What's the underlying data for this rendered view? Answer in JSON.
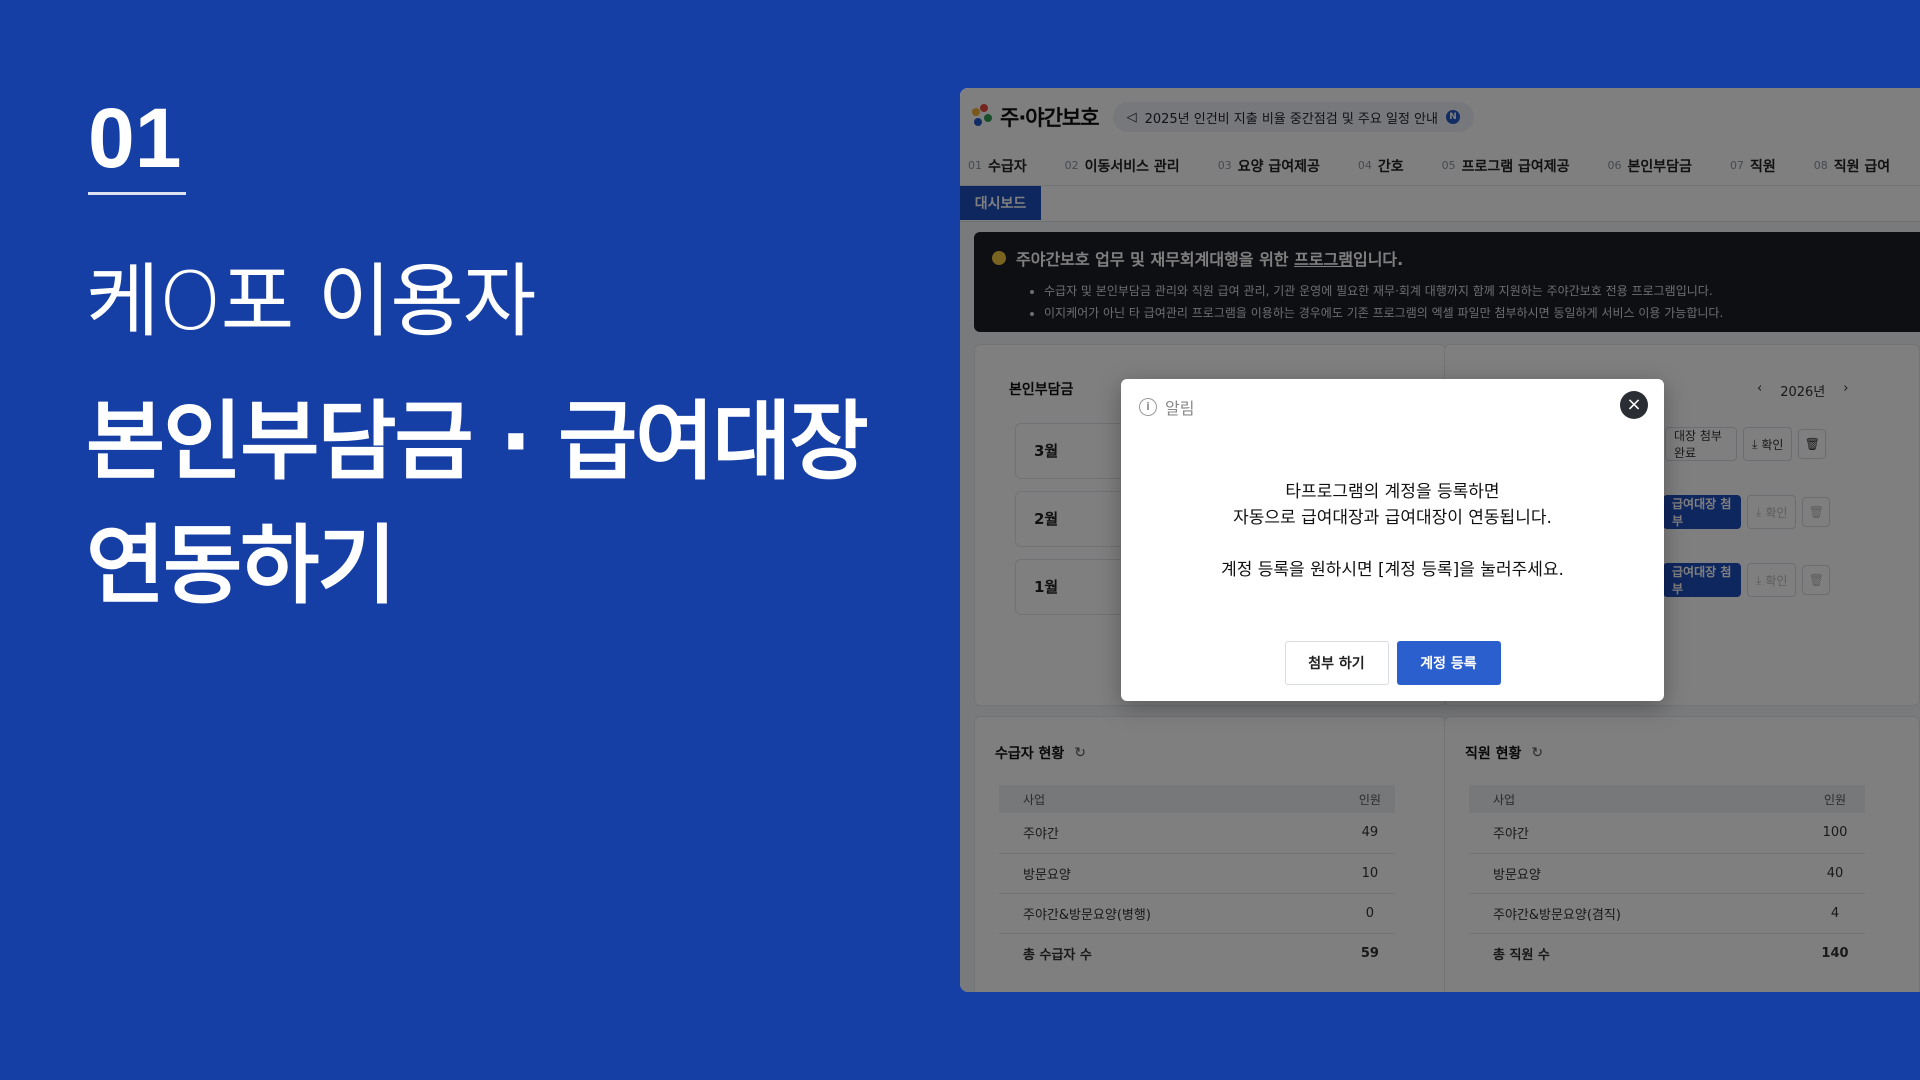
{
  "hero": {
    "number": "01",
    "subtitle": "케O포 이용자",
    "title_line1": "본인부담금 · 급여대장",
    "title_line2": "연동하기"
  },
  "app": {
    "logo": "주·야간보호",
    "notice": "2025년 인건비 지출 비율 중간점검 및 주요 일정 안내",
    "notice_badge": "N",
    "nav": [
      {
        "num": "01",
        "label": "수급자"
      },
      {
        "num": "02",
        "label": "이동서비스 관리"
      },
      {
        "num": "03",
        "label": "요양 급여제공"
      },
      {
        "num": "04",
        "label": "간호"
      },
      {
        "num": "05",
        "label": "프로그램 급여제공"
      },
      {
        "num": "06",
        "label": "본인부담금"
      },
      {
        "num": "07",
        "label": "직원"
      },
      {
        "num": "08",
        "label": "직원 급여"
      }
    ],
    "active_tab": "대시보드",
    "banner": {
      "title_prefix": "주야간보호 업무 및 재무회계대행을 위한 ",
      "title_emph": "프로그램",
      "title_suffix": "입니다.",
      "bullets": [
        "수급자 및 본인부담금 관리와 직원 급여 관리, 기관 운영에 필요한 재무·회계 대행까지 함께 지원하는 주야간보호 전용 프로그램입니다.",
        "이지케어가 아닌 타 급여관리 프로그램을 이용하는 경우에도 기존 프로그램의 엑셀 파일만 첨부하시면 동일하게 서비스 이용 가능합니다."
      ]
    },
    "copay_card": {
      "title": "본인부담금",
      "year": "2026년",
      "months": [
        "3월",
        "2월",
        "1월"
      ],
      "attach_done": "대장 첨부완료",
      "attach_btn": "급여대장 첨부",
      "confirm": "확인"
    },
    "recipients": {
      "title": "수급자 현황",
      "col_biz": "사업",
      "col_count": "인원",
      "rows": [
        {
          "name": "주야간",
          "count": "49"
        },
        {
          "name": "방문요양",
          "count": "10"
        },
        {
          "name": "주야간&방문요양(병행)",
          "count": "0"
        }
      ],
      "total_label": "총 수급자 수",
      "total": "59"
    },
    "staff": {
      "title": "직원 현황",
      "col_biz": "사업",
      "col_count": "인원",
      "rows": [
        {
          "name": "주야간",
          "count": "100"
        },
        {
          "name": "방문요양",
          "count": "40"
        },
        {
          "name": "주야간&방문요양(겸직)",
          "count": "4"
        }
      ],
      "total_label": "총 직원 수",
      "total": "140"
    }
  },
  "modal": {
    "title": "알림",
    "line1": "타프로그램의 계정을 등록하면",
    "line2": "자동으로 급여대장과 급여대장이 연동됩니다.",
    "line3": "계정 등록을 원하시면 [계정 등록]을 눌러주세요.",
    "btn_attach": "첨부 하기",
    "btn_register": "계정 등록"
  },
  "colors": {
    "background": "#163fa6",
    "accent": "#2b5fce",
    "banner": "#1c1f27"
  }
}
